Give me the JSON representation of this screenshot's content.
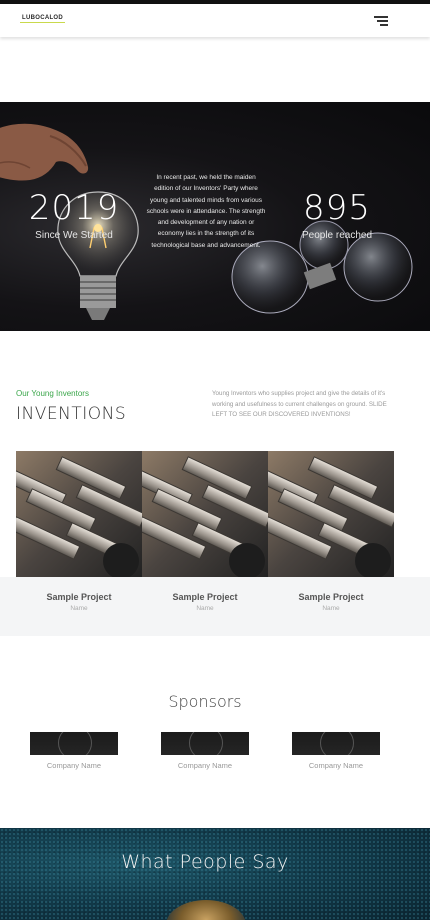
{
  "header": {
    "logo_text": "LUBOCALOD",
    "logo_accent": "CA",
    "menu_icon": "hamburger-menu-icon"
  },
  "hero": {
    "stats": [
      {
        "number": "2019",
        "label": "Since We Started"
      },
      {
        "number": "895",
        "label": "People reached"
      }
    ],
    "paragraph": "In recent past, we held the maiden edition of our Inventors' Party where young and talented minds from various schools were in attendance. The strength and development of any nation or economy lies in the strength of its technological base and advancement."
  },
  "inventions": {
    "tag": "Our Young Inventors",
    "title": "INVENTIONS",
    "description": "Young Inventors who supplies project and give the details of it's working and usefulness to current challenges on ground. SLIDE LEFT TO SEE OUR DISCOVERED INVENTIONS!",
    "projects": [
      {
        "title": "Sample Project",
        "subtitle": "Name"
      },
      {
        "title": "Sample Project",
        "subtitle": "Name"
      },
      {
        "title": "Sample Project",
        "subtitle": "Name"
      }
    ]
  },
  "sponsors": {
    "title": "Sponsors",
    "items": [
      {
        "name": "Company Name"
      },
      {
        "name": "Company Name"
      },
      {
        "name": "Company Name"
      }
    ]
  },
  "testimonials": {
    "title": "What People Say"
  },
  "colors": {
    "accent_green": "#3aa64a",
    "hero_bg": "#0a0a0c",
    "testimonial_bg": "#123b4b"
  }
}
